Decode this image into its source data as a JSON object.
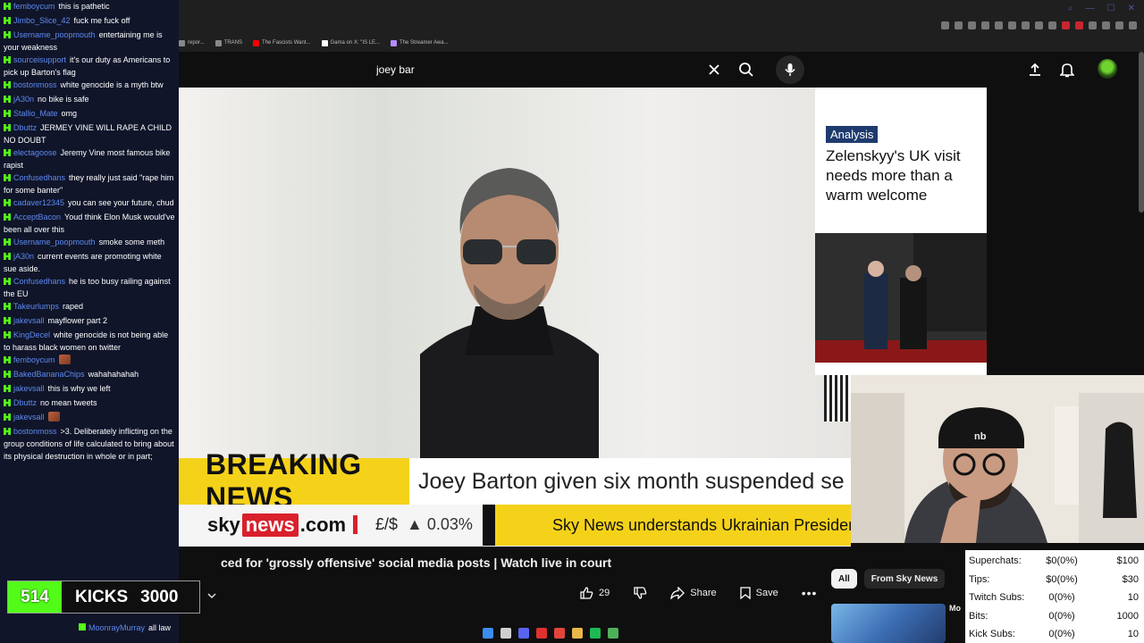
{
  "search": {
    "query": "joey bar"
  },
  "bookmarks": [
    {
      "label": "repor...",
      "color": "#888888"
    },
    {
      "label": "TRANS",
      "color": "#888888"
    },
    {
      "label": "The Fascists Want...",
      "color": "#ff0000"
    },
    {
      "label": "Gama on X: \"IS LE...",
      "color": "#ffffff"
    },
    {
      "label": "The Streamer Awa...",
      "color": "#b58cff"
    }
  ],
  "video": {
    "breaking_label": "BREAKING NEWS",
    "breaking_headline": "Joey Barton given six month suspended se",
    "sky_logo_a": "sky",
    "sky_logo_b": "news",
    "sky_logo_c": ".com",
    "fx_label": "£/$",
    "fx_value": "▲ 0.03%",
    "crawl": "Sky News understands Ukrainian President Volo",
    "analysis_tag": "Analysis",
    "analysis_title": "Zelenskyy's UK visit needs more than a warm welcome",
    "title": "ced for 'grossly offensive' social media posts | Watch live in court",
    "likes": "29",
    "share_label": "Share",
    "save_label": "Save"
  },
  "chips": [
    "All",
    "From Sky News"
  ],
  "up_next_title": "Mo",
  "chat": [
    {
      "user": "femboycum",
      "msg": "this is pathetic"
    },
    {
      "user": "Jimbo_Slice_42",
      "msg": "fuck me fuck off"
    },
    {
      "user": "Username_poopmouth",
      "msg": "entertaining me is your weakness"
    },
    {
      "user": "sourceisupport",
      "msg": "it's our duty as Americans to pick up Barton's flag"
    },
    {
      "user": "bostonmoss",
      "msg": "white genocide is a myth btw"
    },
    {
      "user": "jA30n",
      "msg": "no bike is safe"
    },
    {
      "user": "Stallio_Mate",
      "msg": "omg"
    },
    {
      "user": "Dbuttz",
      "msg": "JERMEY VINE WILL RAPE A CHILD NO DOUBT"
    },
    {
      "user": "electagoose",
      "msg": "Jeremy Vine most famous bike rapist"
    },
    {
      "user": "Confusedhans",
      "msg": "they really just said \"rape him for some banter\""
    },
    {
      "user": "cadaver12345",
      "msg": "you can see your future, chud"
    },
    {
      "user": "AcceptBacon",
      "msg": "Youd think Elon Musk would've been all over this"
    },
    {
      "user": "Username_poopmouth",
      "msg": "smoke some meth"
    },
    {
      "user": "jA30n",
      "msg": "current events are promoting white sue aside."
    },
    {
      "user": "Confusedhans",
      "msg": "he is too busy railing against the EU"
    },
    {
      "user": "Takeurlumps",
      "msg": "raped"
    },
    {
      "user": "jakevsall",
      "msg": "mayflower part 2"
    },
    {
      "user": "KingDecel",
      "msg": "white genocide is not being able to harass black women on twitter"
    },
    {
      "user": "femboycum",
      "msg": ""
    },
    {
      "user": "BakedBananaChips",
      "msg": "wahahahahah"
    },
    {
      "user": "jakevsall",
      "msg": "this is why we left"
    },
    {
      "user": "Dbuttz",
      "msg": "no mean tweets"
    },
    {
      "user": "jakevsall",
      "msg": ""
    },
    {
      "user": "bostonmoss",
      "msg": ">3. Deliberately inflicting on the group conditions of life calculated to bring about its physical destruction in whole or in part;"
    }
  ],
  "chat_last": {
    "user": "MoonrayMurray",
    "msg": "all law"
  },
  "kicks": {
    "count": "514",
    "label": "KICKS",
    "goal": "3000"
  },
  "stats": [
    {
      "label": "Superchats:",
      "current": "$0(0%)",
      "goal": "$100"
    },
    {
      "label": "Tips:",
      "current": "$0(0%)",
      "goal": "$30"
    },
    {
      "label": "Twitch Subs:",
      "current": "0(0%)",
      "goal": "10"
    },
    {
      "label": "Bits:",
      "current": "0(0%)",
      "goal": "1000"
    },
    {
      "label": "Kick Subs:",
      "current": "0(0%)",
      "goal": "10"
    }
  ],
  "colors": {
    "kick_green": "#53fc18",
    "sky_red": "#d8212c",
    "ticker_yellow": "#f5d21a",
    "chat_bg": "#10152a",
    "username_blue": "#5d8af0"
  }
}
